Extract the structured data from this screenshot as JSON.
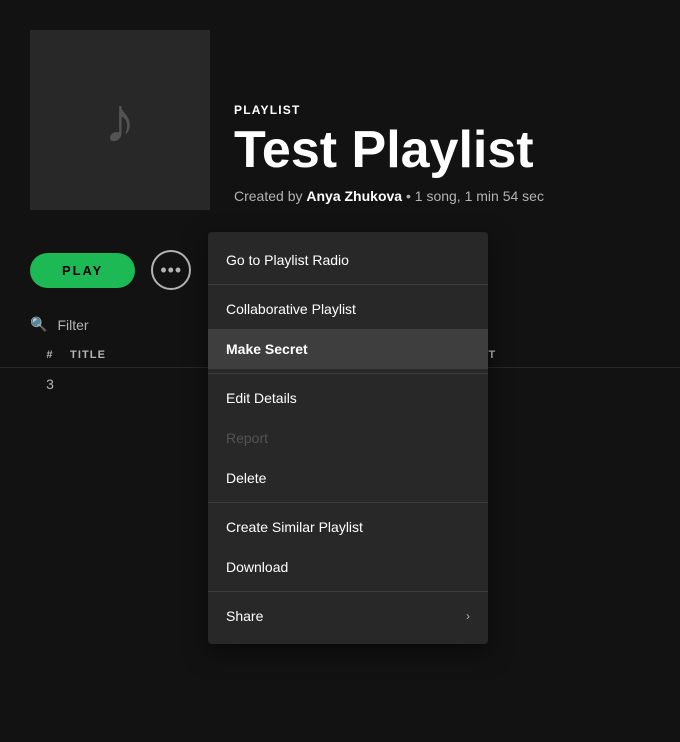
{
  "header": {
    "playlist_type": "PLAYLIST",
    "playlist_title": "Test Playlist",
    "created_by_label": "Created by",
    "creator_name": "Anya Zhukova",
    "meta_details": "1 song, 1 min 54 sec"
  },
  "controls": {
    "play_label": "PLAY",
    "more_dots": "•••"
  },
  "filter": {
    "placeholder": "Filter"
  },
  "track_table": {
    "col_num": "#",
    "col_title": "TITLE",
    "col_artist": "ARTIST",
    "tracks": [
      {
        "num": "3"
      }
    ]
  },
  "context_menu": {
    "items": [
      {
        "id": "goto-radio",
        "label": "Go to Playlist Radio",
        "disabled": false,
        "active": false,
        "has_arrow": false
      },
      {
        "id": "collaborative",
        "label": "Collaborative Playlist",
        "disabled": false,
        "active": false,
        "has_arrow": false
      },
      {
        "id": "make-secret",
        "label": "Make Secret",
        "disabled": false,
        "active": true,
        "has_arrow": false
      },
      {
        "id": "edit-details",
        "label": "Edit Details",
        "disabled": false,
        "active": false,
        "has_arrow": false
      },
      {
        "id": "report",
        "label": "Report",
        "disabled": true,
        "active": false,
        "has_arrow": false
      },
      {
        "id": "delete",
        "label": "Delete",
        "disabled": false,
        "active": false,
        "has_arrow": false
      },
      {
        "id": "create-similar",
        "label": "Create Similar Playlist",
        "disabled": false,
        "active": false,
        "has_arrow": false
      },
      {
        "id": "download",
        "label": "Download",
        "disabled": false,
        "active": false,
        "has_arrow": false
      },
      {
        "id": "share",
        "label": "Share",
        "disabled": false,
        "active": false,
        "has_arrow": true
      }
    ]
  },
  "colors": {
    "green": "#1db954",
    "bg": "#121212",
    "card_bg": "#282828",
    "hover": "#3e3e3e",
    "muted": "#535353",
    "subtle": "#b3b3b3"
  },
  "icons": {
    "search": "🔍",
    "music_note": "♪",
    "chevron_right": "›",
    "more": "···"
  }
}
